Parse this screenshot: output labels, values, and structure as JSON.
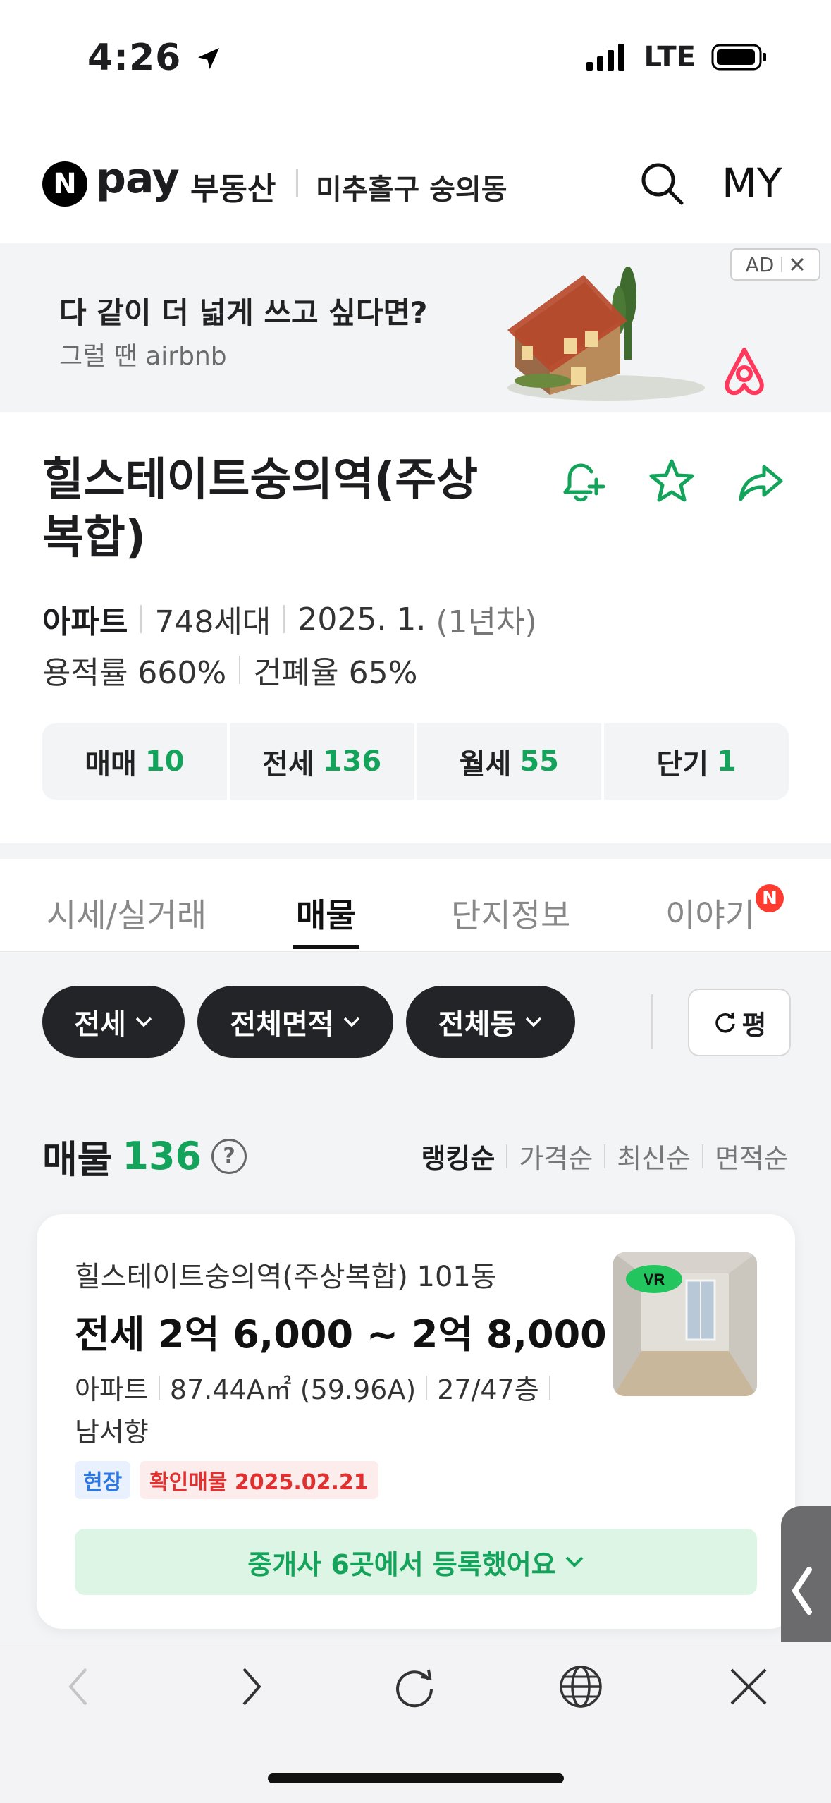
{
  "status_bar": {
    "time": "4:26",
    "network": "LTE"
  },
  "header": {
    "logo_mark": "N",
    "logo_text": "pay",
    "service": "부동산",
    "location": "미추홀구 숭의동",
    "my_label": "MY"
  },
  "ad": {
    "badge": "AD",
    "title": "다 같이 더 넓게 쓰고 싶다면?",
    "subtitle": "그럴 땐 airbnb"
  },
  "complex": {
    "title": "힐스테이트숭의역(주상복합)",
    "type": "아파트",
    "units": "748세대",
    "built": "2025. 1.",
    "age": "(1년차)",
    "far": "용적률 660%",
    "bcr": "건폐율 65%"
  },
  "deals": [
    {
      "label": "매매",
      "count": "10"
    },
    {
      "label": "전세",
      "count": "136"
    },
    {
      "label": "월세",
      "count": "55"
    },
    {
      "label": "단기",
      "count": "1"
    }
  ],
  "tabs": [
    {
      "label": "시세/실거래"
    },
    {
      "label": "매물"
    },
    {
      "label": "단지정보"
    },
    {
      "label": "이야기"
    }
  ],
  "tab_new_badge": "N",
  "filters": {
    "deal_type": "전세",
    "area": "전체면적",
    "dong": "전체동",
    "unit_toggle": "평"
  },
  "listing_summary": {
    "label": "매물",
    "count": "136",
    "help": "?"
  },
  "sort_options": [
    "랭킹순",
    "가격순",
    "최신순",
    "면적순"
  ],
  "listing": {
    "name": "힐스테이트숭의역(주상복합) 101동",
    "price": "전세 2억 6,000 ~ 2억 8,000",
    "type": "아파트",
    "area": "87.44A㎡ (59.96A)",
    "floor": "27/47층",
    "direction": "남서향",
    "tag_site": "현장",
    "tag_verified": "확인매물 2025.02.21",
    "agents_text": "중개사 6곳에서 등록했어요",
    "vr_label": "VR"
  },
  "colors": {
    "accent_green": "#14a35a",
    "chip_dark": "#222428",
    "badge_red": "#ff3b30"
  }
}
